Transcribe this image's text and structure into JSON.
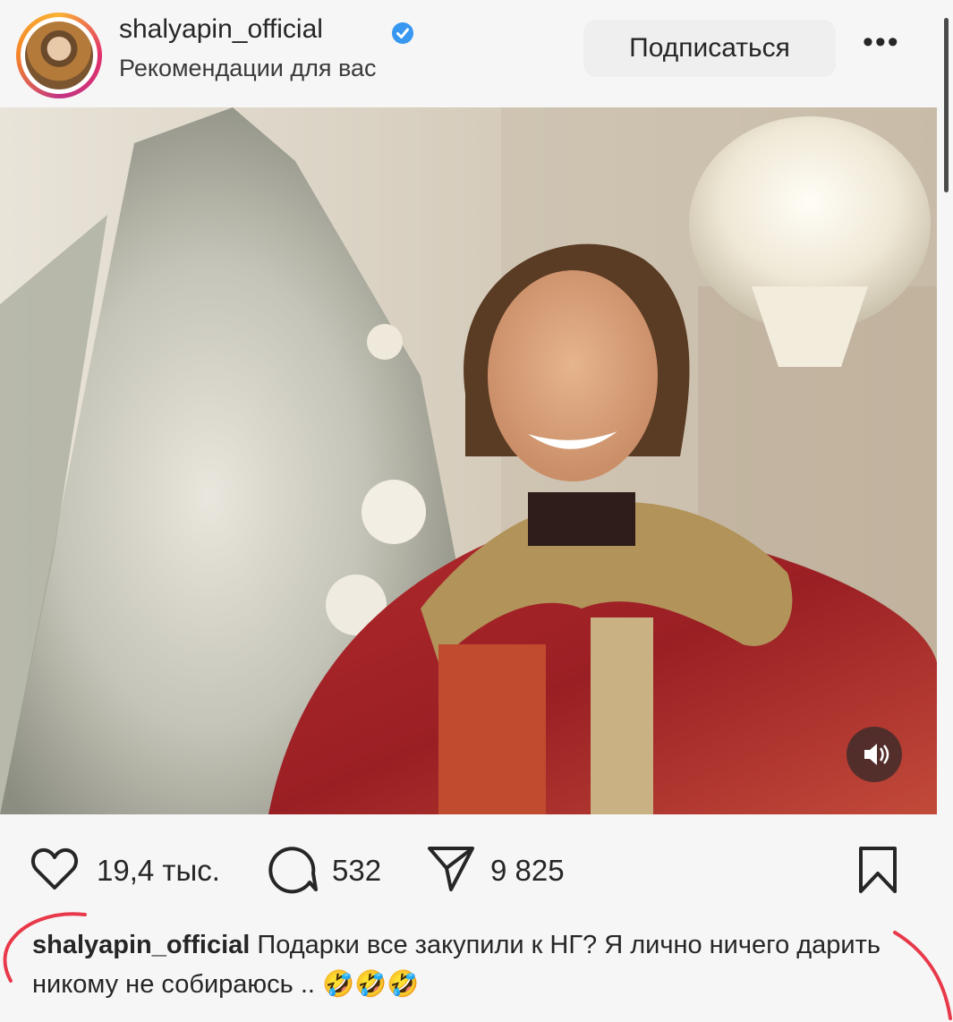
{
  "header": {
    "username": "shalyapin_official",
    "subtitle": "Рекомендации для вас",
    "follow_label": "Подписаться",
    "more_label": "•••"
  },
  "stats": {
    "likes": "19,4 тыс.",
    "comments": "532",
    "shares": "9 825"
  },
  "caption": {
    "username": "shalyapin_official",
    "text": "Подарки все закупили к НГ? Я лично ничего дарить никому не собираюсь ..",
    "emojis": "🤣🤣🤣"
  },
  "colors": {
    "verified": "#3897f0",
    "annotation": "#e8394a"
  },
  "icons": [
    "verified-icon",
    "heart-icon",
    "comment-icon",
    "share-icon",
    "bookmark-icon",
    "sound-icon"
  ]
}
